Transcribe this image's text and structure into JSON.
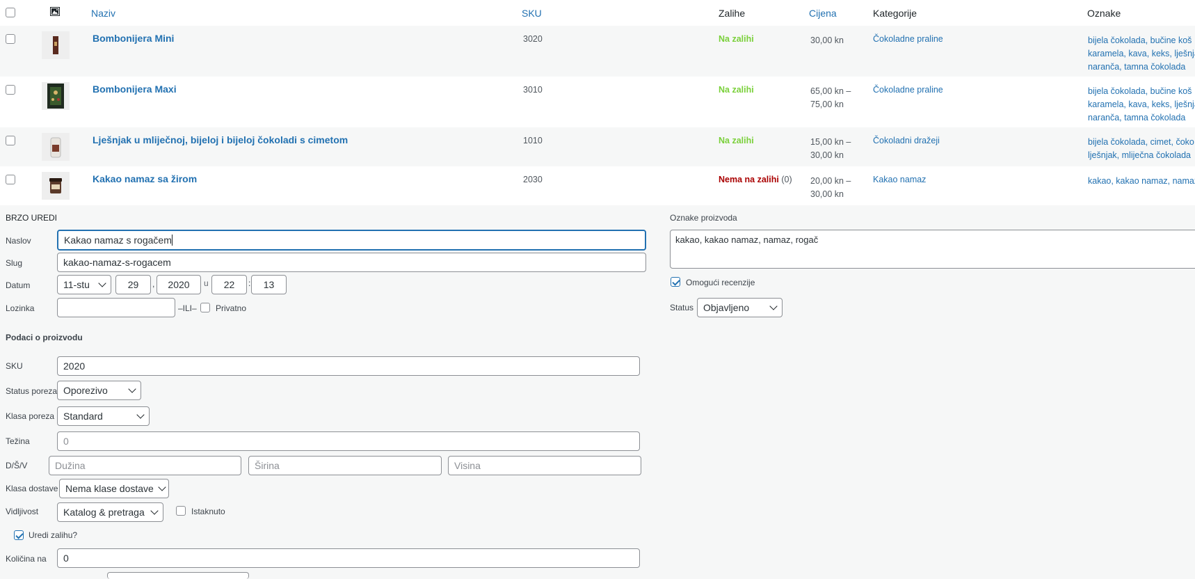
{
  "table_header": {
    "naziv": "Naziv",
    "sku": "SKU",
    "zalihe": "Zalihe",
    "cijena": "Cijena",
    "kategorije": "Kategorije",
    "oznake": "Oznake",
    "image_icon": "image-icon"
  },
  "rows": [
    {
      "name": "Bombonijera Mini",
      "sku": "3020",
      "stock": "Na zalihi",
      "stock_count": "",
      "price_line1": "30,00 kn",
      "price_line2": "",
      "category": "Čokoladne praline",
      "tags_line1": "bijela čokolada, bučine koš",
      "tags_line2": "karamela, kava, keks, lješnja",
      "tags_line3": "naranča, tamna čokolada"
    },
    {
      "name": "Bombonijera Maxi",
      "sku": "3010",
      "stock": "Na zalihi",
      "stock_count": "",
      "price_line1": "65,00 kn –",
      "price_line2": "75,00 kn",
      "category": "Čokoladne praline",
      "tags_line1": "bijela čokolada, bučine koš",
      "tags_line2": "karamela, kava, keks, lješnja",
      "tags_line3": "naranča, tamna čokolada"
    },
    {
      "name": "Lješnjak u mliječnoj, bijeloj i bijeloj čokoladi s cimetom",
      "sku": "1010",
      "stock": "Na zalihi",
      "stock_count": "",
      "price_line1": "15,00 kn –",
      "price_line2": "30,00 kn",
      "category": "Čokoladni dražeji",
      "tags_line1": "bijela čokolada, cimet, čoko",
      "tags_line2": "lješnjak, mliječna čokolada",
      "tags_line3": ""
    },
    {
      "name": "Kakao namaz sa žirom",
      "sku": "2030",
      "stock": "Nema na zalihi",
      "stock_count": "(0)",
      "price_line1": "20,00 kn –",
      "price_line2": "30,00 kn",
      "category": "Kakao namaz",
      "tags_line1": "kakao, kakao namaz, namaz",
      "tags_line2": "",
      "tags_line3": ""
    }
  ],
  "quick_edit": {
    "heading": "BRZO UREDI",
    "naslov_label": "Naslov",
    "naslov_value": "Kakao namaz s rogačem",
    "slug_label": "Slug",
    "slug_value": "kakao-namaz-s-rogacem",
    "datum_label": "Datum",
    "datum_month": "11-stu",
    "datum_day": "29",
    "datum_year": "2020",
    "datum_u": "u",
    "datum_hour": "22",
    "datum_min": "13",
    "datum_comma": ",",
    "datum_colon": ":",
    "lozinka_label": "Lozinka",
    "lozinka_ili": "–ILI–",
    "privatno_label": "Privatno",
    "tags_label": "Oznake proizvoda",
    "tags_value": "kakao, kakao namaz, namaz, rogač",
    "reviews_label": "Omogući recenzije",
    "status_label": "Status",
    "status_value": "Objavljeno",
    "product_data_heading": "Podaci o proizvodu",
    "sku_label": "SKU",
    "sku_value": "2020",
    "tax_status_label": "Status poreza",
    "tax_status_value": "Oporezivo",
    "tax_class_label": "Klasa poreza",
    "tax_class_value": "Standard",
    "weight_label": "Težina",
    "weight_placeholder": "0",
    "dims_label": "D/Š/V",
    "length_placeholder": "Dužina",
    "width_placeholder": "Širina",
    "height_placeholder": "Visina",
    "shipping_label": "Klasa dostave",
    "shipping_value": "Nema klase dostave",
    "visibility_label": "Vidljivost",
    "visibility_value": "Katalog & pretraga",
    "featured_label": "Istaknuto",
    "manage_stock_label": "Uredi zalihu?",
    "qty_label": "Količina na",
    "qty_value": "0"
  }
}
